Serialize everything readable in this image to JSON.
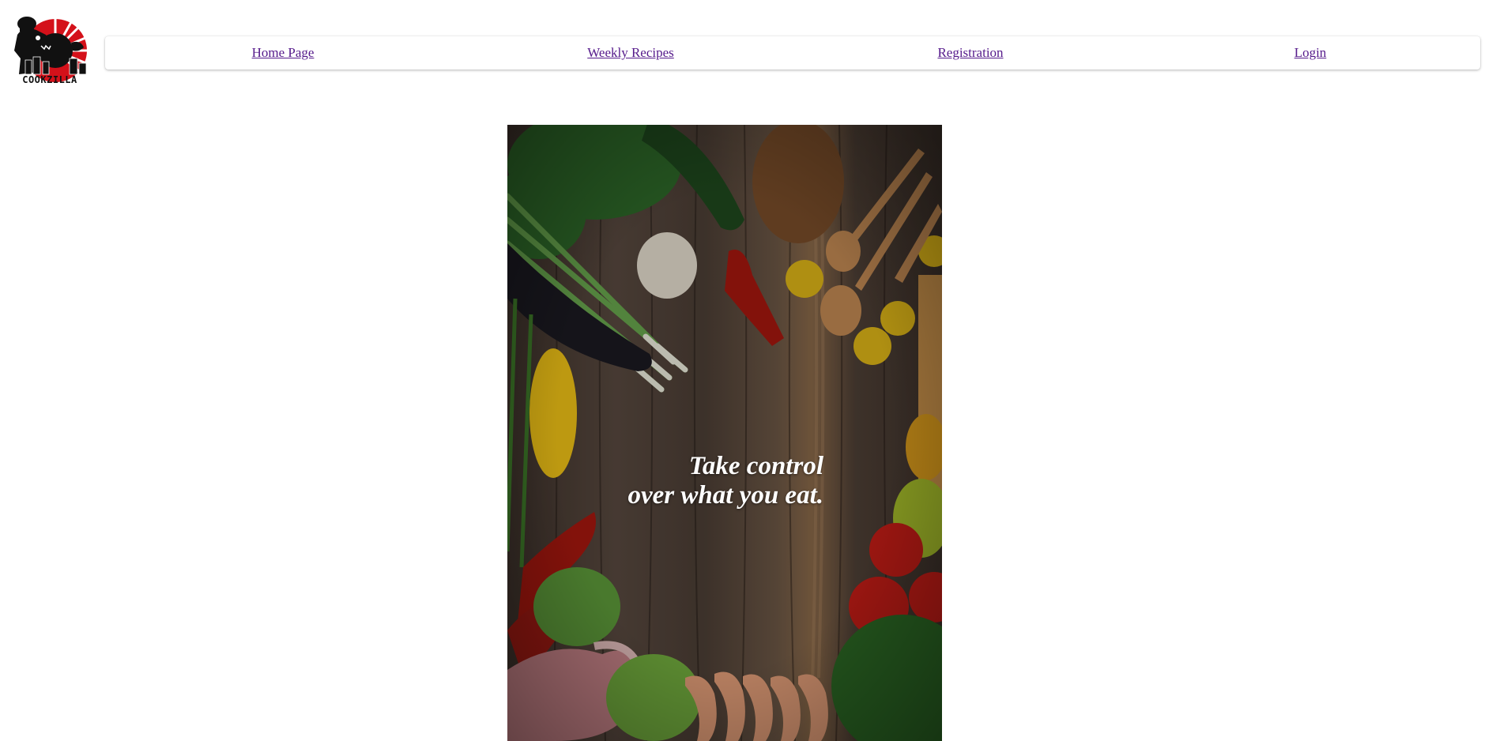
{
  "logo": {
    "text": "COOKZILLA",
    "icon": "chef-monster-logo",
    "colors": {
      "red": "#d4111a",
      "black": "#111111"
    }
  },
  "nav": {
    "items": [
      {
        "label": "Home Page"
      },
      {
        "label": "Weekly Recipes"
      },
      {
        "label": "Registration"
      },
      {
        "label": "Login"
      }
    ],
    "link_color": "#551a8b"
  },
  "hero": {
    "image": "vegetables-on-wooden-table",
    "line1": "Take control",
    "line2": "over what you eat."
  }
}
